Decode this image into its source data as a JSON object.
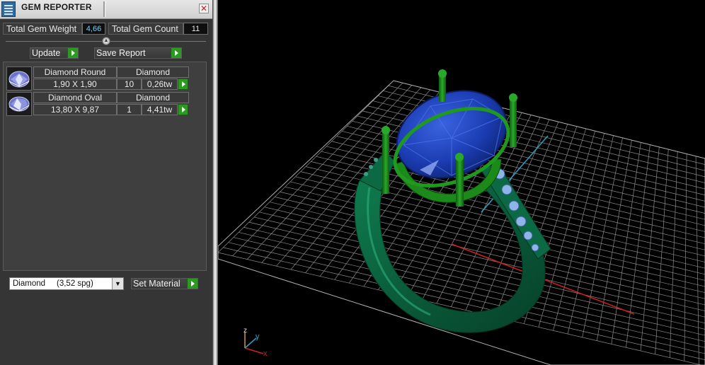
{
  "window": {
    "title": "GEM REPORTER",
    "close_symbol": "✕"
  },
  "totals": {
    "weight_label": "Total Gem Weight",
    "weight_value": "4,66",
    "count_label": "Total Gem Count",
    "count_value": "11"
  },
  "toolbar": {
    "update_label": "Update",
    "save_label": "Save Report"
  },
  "gems": [
    {
      "name": "Diamond Round",
      "material": "Diamond",
      "size": "1,90 X 1,90",
      "count": "10",
      "weight": "0,26tw",
      "icon": "round-gem-icon"
    },
    {
      "name": "Diamond Oval",
      "material": "Diamond",
      "size": "13,80 X 9,87",
      "count": "1",
      "weight": "4,41tw",
      "icon": "oval-gem-icon"
    }
  ],
  "material": {
    "selected": "Diamond     (3,52 spg)",
    "set_label": "Set Material"
  },
  "viewport": {
    "axis_z": "z",
    "axis_y": "y",
    "axis_x": "x"
  },
  "colors": {
    "accent_green": "#2c9a21",
    "value_cyan": "#6fd3ff",
    "ring_green": "#0c6b42",
    "prong_green": "#1a8a1a",
    "stone_blue": "#1f3fb0",
    "axis_red": "#d02020",
    "axis_cyan": "#2aa3c6"
  }
}
